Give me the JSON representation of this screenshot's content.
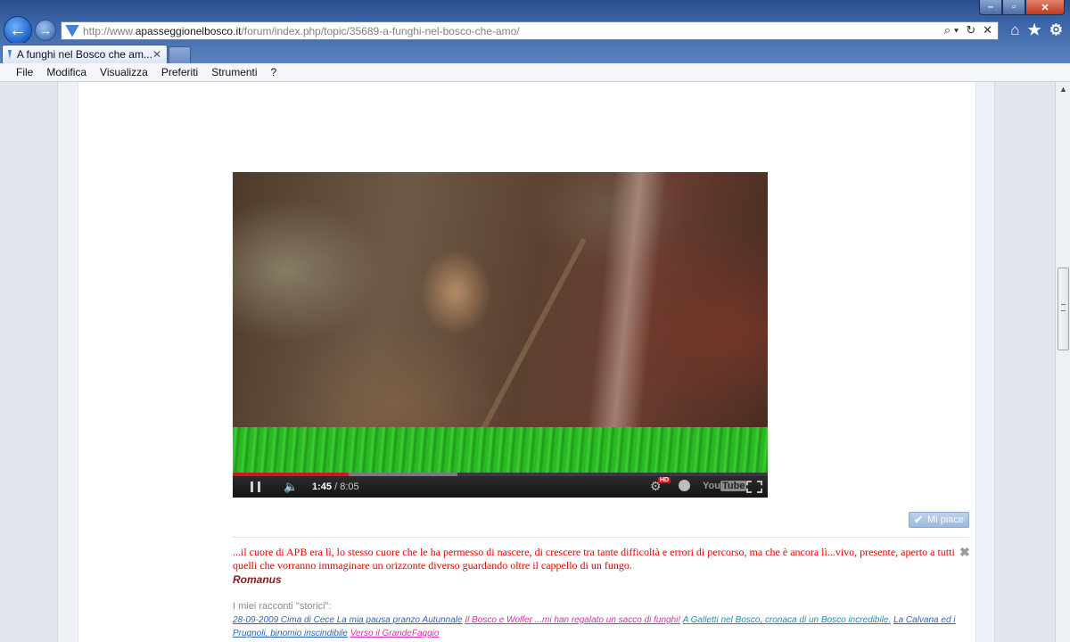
{
  "browser": {
    "url_prefix": "http://www.",
    "url_domain": "apasseggionelbosco.it",
    "url_path": "/forum/index.php/topic/35689-a-funghi-nel-bosco-che-amo/",
    "tab_title": "A funghi nel Bosco che am...",
    "menu": [
      "File",
      "Modifica",
      "Visualizza",
      "Preferiti",
      "Strumenti",
      "?"
    ]
  },
  "video": {
    "current_time": "1:45",
    "duration": "/ 8:05",
    "played_fraction": 0.216,
    "buffered_fraction": 0.42,
    "hd_badge": "HD",
    "logo_you": "You",
    "logo_tube": "Tube"
  },
  "post": {
    "like_label": "Mi piace",
    "quote": "...il cuore di APB era lì, lo stesso cuore che le ha permesso di nascere, di crescere tra tante difficoltà e errori di percorso, ma che è ancora lì...vivo, presente, aperto a tutti quelli che vorranno immaginare un orizzonte diverso guardando oltre il cappello di un fungo.",
    "author": "Romanus",
    "stories_title": "I miei racconti \"storici\":",
    "stories": [
      {
        "text": "28-09-2009 Cima di Cece La mia pausa pranzo Autunnale",
        "color": "#2a66b8"
      },
      {
        "text": "Il Bosco e Wolfer ...mi han regalato un sacco di funghi!",
        "color": "#d42fb0"
      },
      {
        "text": "A Galletti nel Bosco, cronaca di un Bosco incredibile.",
        "color": "#1a8fb5"
      },
      {
        "text": "La Calvana ed i Prugnoli, binomio inscindibile",
        "color": "#2a66b8"
      },
      {
        "text": "Verso il GrandeFaggio",
        "color": "#d42fb0"
      }
    ]
  }
}
